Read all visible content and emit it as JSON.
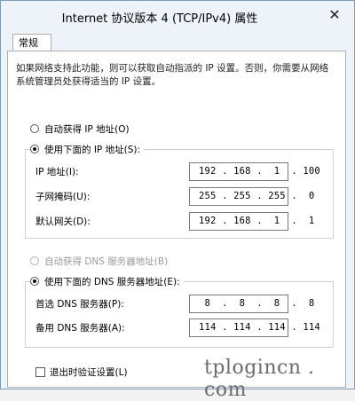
{
  "window": {
    "title": "Internet 协议版本 4 (TCP/IPv4) 属性",
    "close_glyph": "✕"
  },
  "tabs": [
    {
      "label": "常规",
      "selected": true
    }
  ],
  "description": "如果网络支持此功能，则可以获取自动指派的 IP 设置。否则，你需要从网络系统管理员处获得适当的 IP 设置。",
  "ip_section": {
    "auto_label": "自动获得 IP 地址(O)",
    "auto_selected": false,
    "manual_label": "使用下面的 IP 地址(S):",
    "manual_selected": true,
    "fields": [
      {
        "label": "IP 地址(I):",
        "value": "192 . 168 .  1  . 100"
      },
      {
        "label": "子网掩码(U):",
        "value": "255 . 255 . 255 .  0"
      },
      {
        "label": "默认网关(D):",
        "value": "192 . 168 .  1  .  1"
      }
    ]
  },
  "dns_section": {
    "auto_label": "自动获得 DNS 服务器地址(B)",
    "auto_selected": false,
    "auto_disabled": true,
    "manual_label": "使用下面的 DNS 服务器地址(E):",
    "manual_selected": true,
    "fields": [
      {
        "label": "首选 DNS 服务器(P):",
        "value": " 8  .  8  .  8  .  8"
      },
      {
        "label": "备用 DNS 服务器(A):",
        "value": "114 . 114 . 114 . 114"
      }
    ]
  },
  "validate_on_exit": {
    "label": "退出时验证设置(L)",
    "checked": false
  },
  "watermark": "tplogincn . com",
  "colors": {
    "title_bg": "#eef3fa",
    "panel_bg": "#ffffff",
    "disabled_text": "#9a9a9a"
  }
}
